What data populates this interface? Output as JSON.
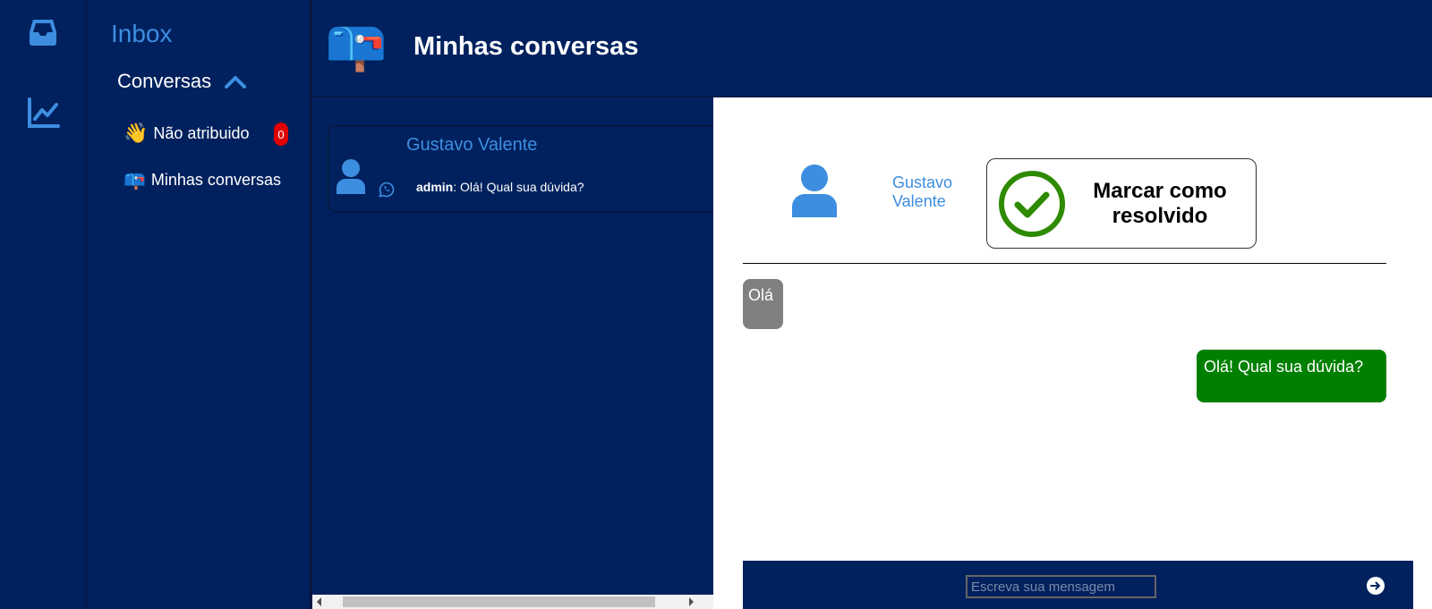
{
  "rail": {
    "icons": [
      "inbox-icon",
      "chart-line-icon"
    ]
  },
  "sidebar": {
    "title": "Inbox",
    "section": {
      "label": "Conversas",
      "icon": "chevron-up-icon"
    },
    "items": [
      {
        "emoji": "👋",
        "label": "Não atribuido",
        "badge": "0"
      },
      {
        "emoji": "📪",
        "label": "Minhas conversas"
      }
    ]
  },
  "header": {
    "emoji": "📪",
    "title": "Minhas conversas"
  },
  "conversations": [
    {
      "name": "Gustavo Valente",
      "channel_icon": "whatsapp-icon",
      "last_sender": "admin",
      "last_message": ": Olá! Qual sua dúvida?"
    }
  ],
  "chat": {
    "contact_name": "Gustavo Valente",
    "resolve_label": "Marcar como resolvido",
    "messages": [
      {
        "direction": "in",
        "text": "Olá"
      },
      {
        "direction": "out",
        "text": "Olá! Qual sua dúvida?"
      }
    ],
    "input_placeholder": "Escreva sua mensagem"
  },
  "colors": {
    "background": "#00215e",
    "accent": "#3d8ee0",
    "incoming_bubble": "#808080",
    "outgoing_bubble": "#008000",
    "resolve_check": "#2e8b00",
    "badge": "#e00000"
  }
}
